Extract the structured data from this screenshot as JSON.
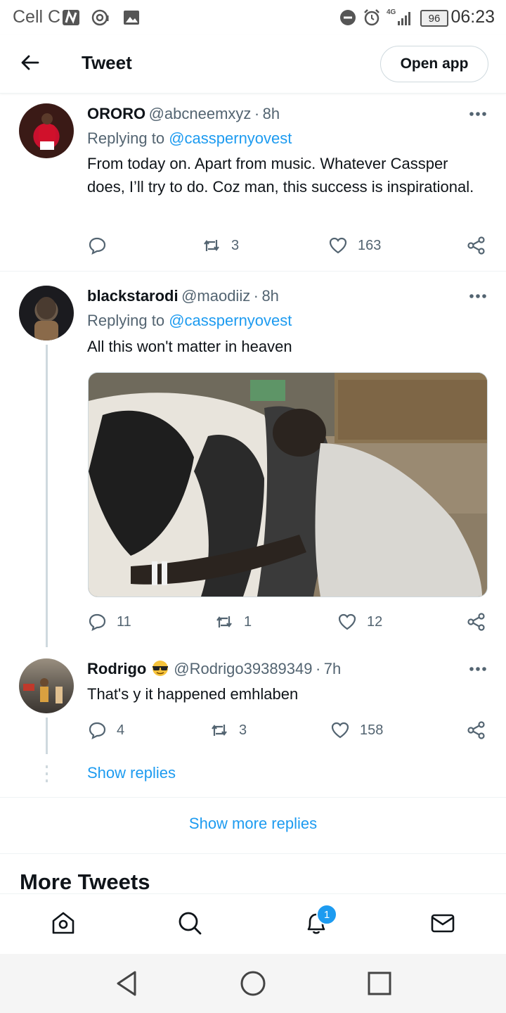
{
  "status_bar": {
    "carrier": "Cell C",
    "network": "4G",
    "battery": "96",
    "time": "06:23"
  },
  "header": {
    "title": "Tweet",
    "open_app_label": "Open app"
  },
  "tweets": [
    {
      "name": "ORORO",
      "handle": "@abcneemxyz",
      "time": "8h",
      "replying_label": "Replying to",
      "replying_to": "@casspernyovest",
      "text": "From today on. Apart from music. Whatever Cassper does, I’ll try to do. Coz man, this success is inspirational.",
      "replies": "",
      "retweets": "3",
      "likes": "163"
    },
    {
      "name": "blackstarodi",
      "handle": "@maodiiz",
      "time": "8h",
      "replying_label": "Replying to",
      "replying_to": "@casspernyovest",
      "text": "All this won't matter in heaven",
      "replies": "11",
      "retweets": "1",
      "likes": "12"
    },
    {
      "name": "Rodrigo",
      "handle": "@Rodrigo39389349",
      "time": "7h",
      "text": "That's y it happened emhlaben",
      "replies": "4",
      "retweets": "3",
      "likes": "158"
    }
  ],
  "show_replies_label": "Show replies",
  "show_more_replies_label": "Show more replies",
  "more_tweets_title": "More Tweets",
  "bottom_nav": {
    "notification_count": "1"
  },
  "colors": {
    "accent": "#1d9bf0",
    "secondary_text": "#536471"
  }
}
